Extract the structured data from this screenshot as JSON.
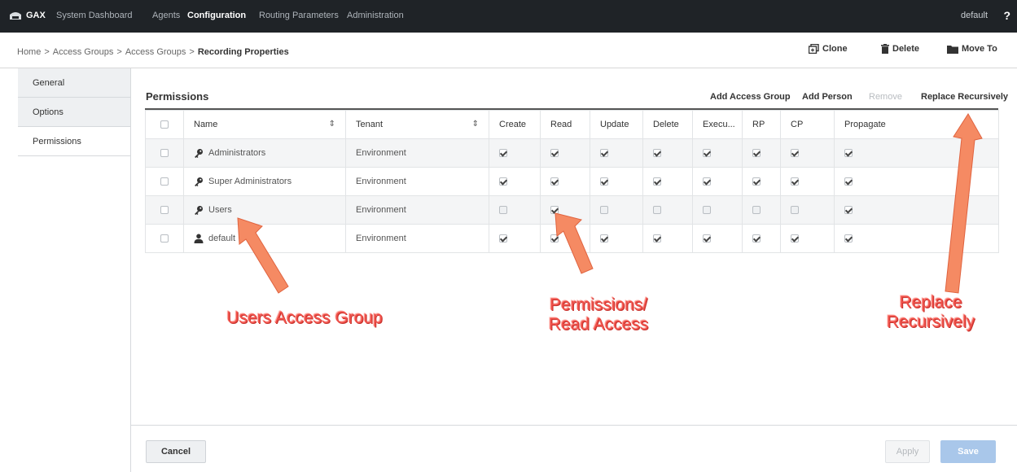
{
  "topbar": {
    "brand": "GAX",
    "nav": [
      {
        "label": "System Dashboard",
        "active": false
      },
      {
        "label": "Agents",
        "active": false
      },
      {
        "label": "Configuration",
        "active": true
      },
      {
        "label": "Routing Parameters",
        "active": false
      },
      {
        "label": "Administration",
        "active": false
      }
    ],
    "user": "default",
    "help": "?"
  },
  "breadcrumb": {
    "items": [
      "Home",
      "Access Groups",
      "Access Groups"
    ],
    "current": "Recording Properties",
    "separator": ">"
  },
  "actions": {
    "clone": "Clone",
    "delete": "Delete",
    "move_to": "Move To"
  },
  "sidebar": {
    "items": [
      {
        "label": "General",
        "active": false
      },
      {
        "label": "Options",
        "active": false
      },
      {
        "label": "Permissions",
        "active": true
      }
    ]
  },
  "permissions": {
    "title": "Permissions",
    "links": {
      "add_access_group": "Add Access Group",
      "add_person": "Add Person",
      "remove": "Remove",
      "replace_recursively": "Replace Recursively"
    },
    "columns": [
      "Name",
      "Tenant",
      "Create",
      "Read",
      "Update",
      "Delete",
      "Execu...",
      "RP",
      "CP",
      "Propagate"
    ],
    "rows": [
      {
        "name": "Administrators",
        "icon": "key-icon",
        "tenant": "Environment",
        "flags": [
          true,
          true,
          true,
          true,
          true,
          true,
          true,
          true
        ]
      },
      {
        "name": "Super Administrators",
        "icon": "key-icon",
        "tenant": "Environment",
        "flags": [
          true,
          true,
          true,
          true,
          true,
          true,
          true,
          true
        ]
      },
      {
        "name": "Users",
        "icon": "key-icon",
        "tenant": "Environment",
        "flags": [
          false,
          true,
          false,
          false,
          false,
          false,
          false,
          true
        ]
      },
      {
        "name": "default",
        "icon": "person-icon",
        "tenant": "Environment",
        "flags": [
          true,
          true,
          true,
          true,
          true,
          true,
          true,
          true
        ]
      }
    ]
  },
  "buttons": {
    "cancel": "Cancel",
    "apply": "Apply",
    "save": "Save"
  },
  "annotations": {
    "users_group": "Users Access Group",
    "read_line1": "Permissions/",
    "read_line2": "Read Access",
    "replace_line1": "Replace",
    "replace_line2": "Recursively",
    "color": "#f0524b"
  }
}
